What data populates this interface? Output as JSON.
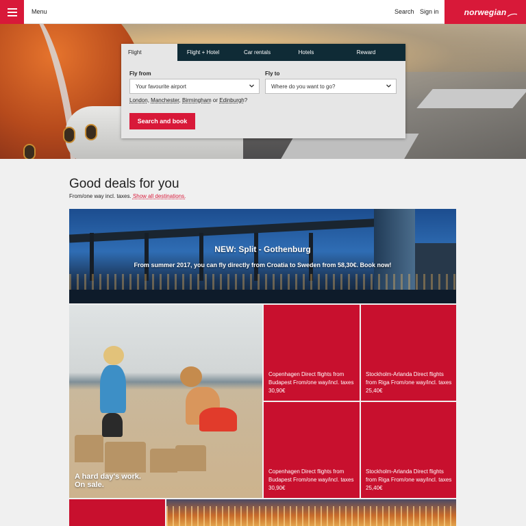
{
  "header": {
    "menu_label": "Menu",
    "search_label": "Search",
    "signin_label": "Sign in",
    "brand": "norwegian"
  },
  "booking": {
    "tabs": [
      {
        "label": "Flight",
        "active": true
      },
      {
        "label": "Flight + Hotel",
        "active": false
      },
      {
        "label": "Car rentals",
        "active": false
      },
      {
        "label": "Hotels",
        "active": false
      },
      {
        "label": "Reward",
        "active": false
      }
    ],
    "fly_from_label": "Fly from",
    "fly_from_value": "Your favourite airport",
    "fly_to_label": "Fly to",
    "fly_to_value": "Where do you want to go?",
    "suggestions": [
      "London",
      "Manchester",
      "Birmingham",
      "Edinburgh"
    ],
    "suggest_sep_comma": ",",
    "suggest_or": "or",
    "suggest_end": "?",
    "cta_label": "Search and book"
  },
  "deals": {
    "title": "Good deals for you",
    "subtitle": "From/one way incl. taxes.",
    "show_all": "Show all destinations.",
    "banner_title": "NEW: Split - Gothenburg",
    "banner_text": "From summer 2017, you can fly directly from Croatia to Sweden from 58,30€. Book now!",
    "beach_caption_line1": "A hard day's work.",
    "beach_caption_line2": "On sale.",
    "tiles": [
      {
        "text": "Copenhagen Direct flights from Budapest From/one way/incl. taxes 30,90€"
      },
      {
        "text": "Stockholm-Arlanda Direct flights from Riga From/one way/incl. taxes 25,40€"
      },
      {
        "text": "Copenhagen Direct flights from Budapest From/one way/incl. taxes 30,90€"
      },
      {
        "text": "Stockholm-Arlanda Direct flights from Riga From/one way/incl. taxes 25,40€"
      }
    ]
  },
  "colors": {
    "brand_red": "#d81939",
    "tile_red": "#c8102e",
    "tab_bar": "#0f2b36"
  },
  "icons": {
    "menu": "hamburger-icon",
    "select_chevron": "chevron-down-icon"
  }
}
